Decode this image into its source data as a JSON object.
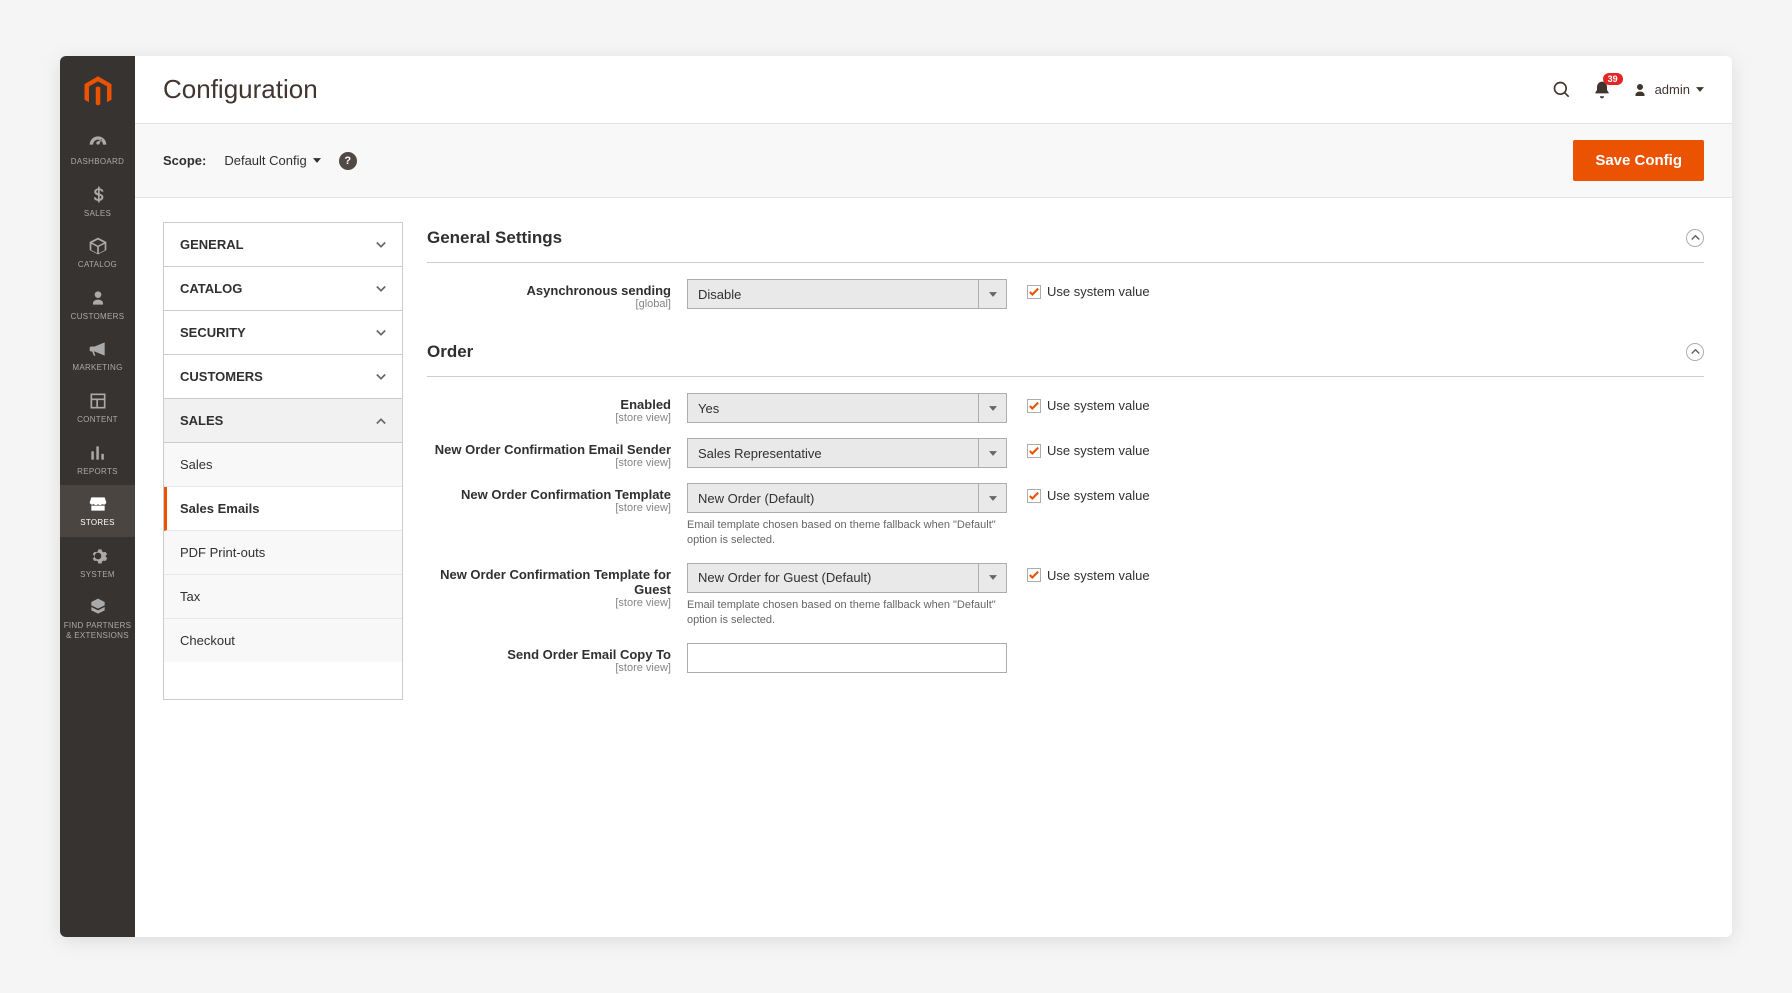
{
  "sidebar": {
    "items": [
      {
        "label": "DASHBOARD"
      },
      {
        "label": "SALES"
      },
      {
        "label": "CATALOG"
      },
      {
        "label": "CUSTOMERS"
      },
      {
        "label": "MARKETING"
      },
      {
        "label": "CONTENT"
      },
      {
        "label": "REPORTS"
      },
      {
        "label": "STORES"
      },
      {
        "label": "SYSTEM"
      },
      {
        "label": "FIND PARTNERS\n& EXTENSIONS"
      }
    ]
  },
  "header": {
    "title": "Configuration",
    "notifications_count": "39",
    "user_label": "admin"
  },
  "scope": {
    "label": "Scope:",
    "value": "Default Config",
    "save_label": "Save Config"
  },
  "tabs": {
    "groups": [
      {
        "label": "GENERAL"
      },
      {
        "label": "CATALOG"
      },
      {
        "label": "SECURITY"
      },
      {
        "label": "CUSTOMERS"
      },
      {
        "label": "SALES"
      }
    ],
    "subs": [
      {
        "label": "Sales"
      },
      {
        "label": "Sales Emails"
      },
      {
        "label": "PDF Print-outs"
      },
      {
        "label": "Tax"
      },
      {
        "label": "Checkout"
      }
    ]
  },
  "sections": {
    "general": {
      "title": "General Settings",
      "fields": {
        "async": {
          "label": "Asynchronous sending",
          "scope": "[global]",
          "value": "Disable",
          "use_system": "Use system value"
        }
      }
    },
    "order": {
      "title": "Order",
      "fields": {
        "enabled": {
          "label": "Enabled",
          "scope": "[store view]",
          "value": "Yes",
          "use_system": "Use system value"
        },
        "sender": {
          "label": "New Order Confirmation Email Sender",
          "scope": "[store view]",
          "value": "Sales Representative",
          "use_system": "Use system value"
        },
        "template": {
          "label": "New Order Confirmation Template",
          "scope": "[store view]",
          "value": "New Order (Default)",
          "note": "Email template chosen based on theme fallback when \"Default\" option is selected.",
          "use_system": "Use system value"
        },
        "guest_template": {
          "label": "New Order Confirmation Template for Guest",
          "scope": "[store view]",
          "value": "New Order for Guest (Default)",
          "note": "Email template chosen based on theme fallback when \"Default\" option is selected.",
          "use_system": "Use system value"
        },
        "copy_to": {
          "label": "Send Order Email Copy To",
          "scope": "[store view]",
          "value": ""
        }
      }
    }
  }
}
